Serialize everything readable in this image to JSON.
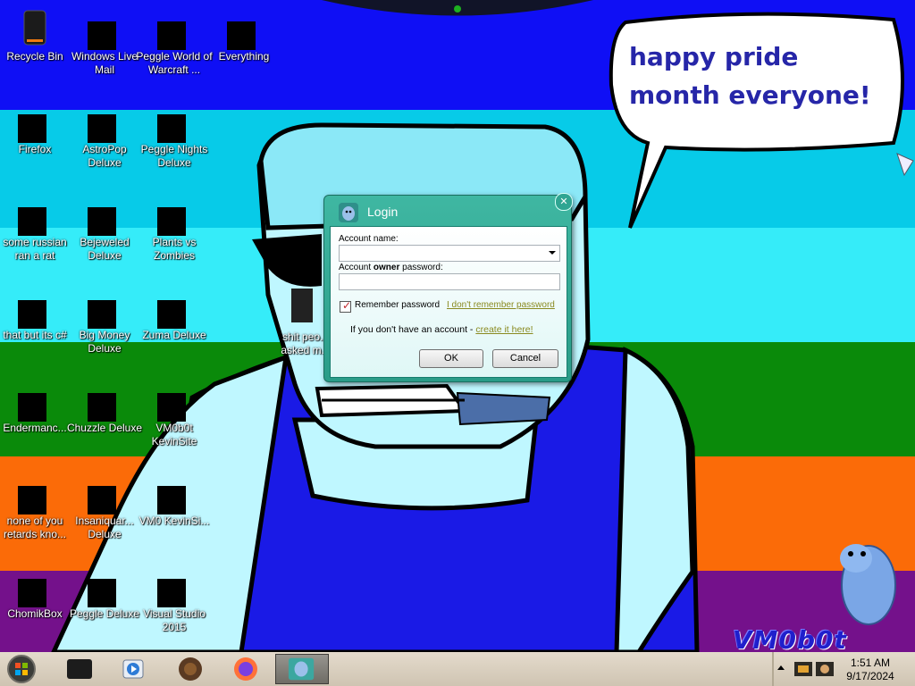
{
  "desktop": {
    "speech_bubble": "happy pride month everyone!",
    "watermark": "VM0b0t",
    "icons": [
      {
        "label": "Recycle Bin"
      },
      {
        "label": "Windows Live Mail"
      },
      {
        "label": "Peggle World of Warcraft ..."
      },
      {
        "label": "Everything"
      },
      {
        "label": "Firefox"
      },
      {
        "label": "AstroPop Deluxe"
      },
      {
        "label": "Peggle Nights Deluxe"
      },
      {
        "label": "some russian ran a rat"
      },
      {
        "label": "Bejeweled Deluxe"
      },
      {
        "label": "Plants vs Zombies"
      },
      {
        "label": "that but its c#"
      },
      {
        "label": "Big Money Deluxe"
      },
      {
        "label": "Zuma Deluxe"
      },
      {
        "label": "Endermanc..."
      },
      {
        "label": "Chuzzle Deluxe"
      },
      {
        "label": "VM0b0t KevinSite"
      },
      {
        "label": "none of you retards kno..."
      },
      {
        "label": "Insaniquar... Deluxe"
      },
      {
        "label": "VM0 KevinSi..."
      },
      {
        "label": "ChomikBox"
      },
      {
        "label": "Peggle Deluxe"
      },
      {
        "label": "Visual Studio 2015"
      },
      {
        "label": "shit peo... asked m..."
      }
    ]
  },
  "login_dialog": {
    "title": "Login",
    "account_name_label": "Account name:",
    "password_label_pre": "Account ",
    "password_label_bold": "owner",
    "password_label_post": " password:",
    "remember_label": "Remember password",
    "forgot_link": "I don't remember password",
    "no_account_text": "If you don't have an account - ",
    "create_link": "create it here!",
    "ok_label": "OK",
    "cancel_label": "Cancel",
    "remember_checked": true
  },
  "taskbar": {
    "apps": [
      "window-icon",
      "media-player-icon",
      "peggle-icon",
      "firefox-icon",
      "chomikbox-icon"
    ],
    "active_app": "chomikbox-icon",
    "clock_time": "1:51 AM",
    "clock_date": "9/17/2024"
  },
  "colors": {
    "stripe_blue": "#0f0ff5",
    "stripe_cyan": "#07cbe8",
    "stripe_lightcyan": "#35ecf9",
    "stripe_green": "#0a8a0a",
    "stripe_orange": "#fb6b08",
    "stripe_purple": "#74118b",
    "dialog_teal": "#36ad99"
  }
}
